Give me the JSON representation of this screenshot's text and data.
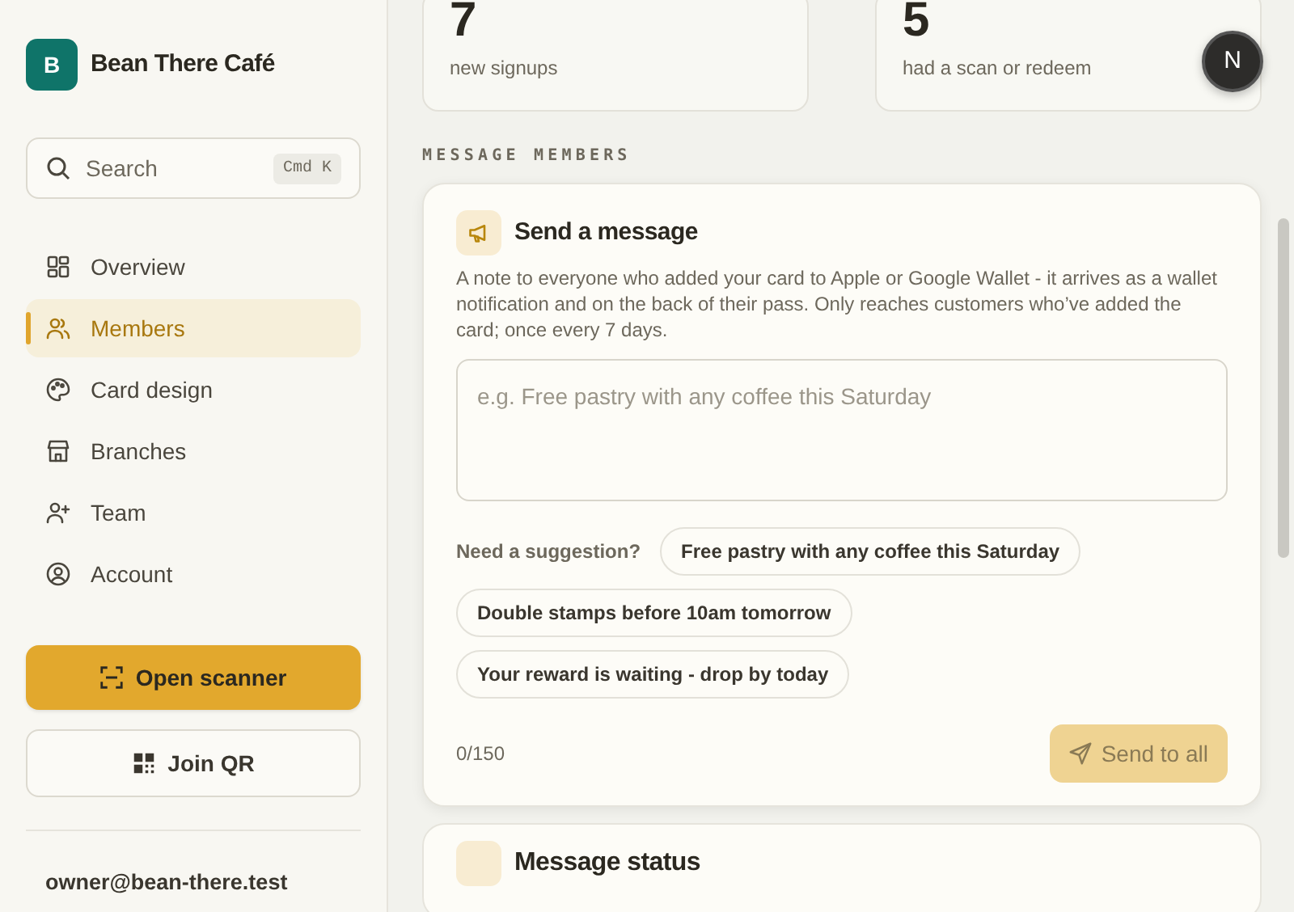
{
  "brand": {
    "initial": "B",
    "name": "Bean There Café"
  },
  "search": {
    "placeholder": "Search",
    "shortcut": "Cmd K"
  },
  "nav": [
    {
      "label": "Overview",
      "kind": "grid",
      "selected": false
    },
    {
      "label": "Members",
      "kind": "users",
      "selected": true
    },
    {
      "label": "Card design",
      "kind": "palette",
      "selected": false
    },
    {
      "label": "Branches",
      "kind": "store",
      "selected": false
    },
    {
      "label": "Team",
      "kind": "invite",
      "selected": false
    },
    {
      "label": "Account",
      "kind": "profile",
      "selected": false
    }
  ],
  "sidebar_buttons": [
    {
      "label": "Open scanner",
      "kind": "primary"
    },
    {
      "label": "Join QR",
      "kind": "outline"
    }
  ],
  "user_email": "owner@bean-there.test",
  "stats": [
    {
      "value": "7",
      "label": "new signups"
    },
    {
      "value": "5",
      "label": "had a scan or redeem"
    }
  ],
  "avatar": {
    "initial": "N"
  },
  "section_label": "MESSAGE MEMBERS",
  "message_card": {
    "title": "Send a message",
    "description": "A note to everyone who added your card to Apple or Google Wallet - it arrives as a wallet notification and on the back of their pass. Only reaches customers who’ve added the card; once every 7 days.",
    "placeholder": "e.g. Free pastry with any coffee this Saturday",
    "suggestion_label": "Need a suggestion?",
    "suggestions": [
      "Free pastry with any coffee this Saturday",
      "Double stamps before 10am tomorrow",
      "Your reward is waiting - drop by today"
    ],
    "counter": "0/150",
    "send_button": {
      "label": "Send to all",
      "disabled": true
    }
  },
  "next_card": {
    "title": "Message status"
  }
}
